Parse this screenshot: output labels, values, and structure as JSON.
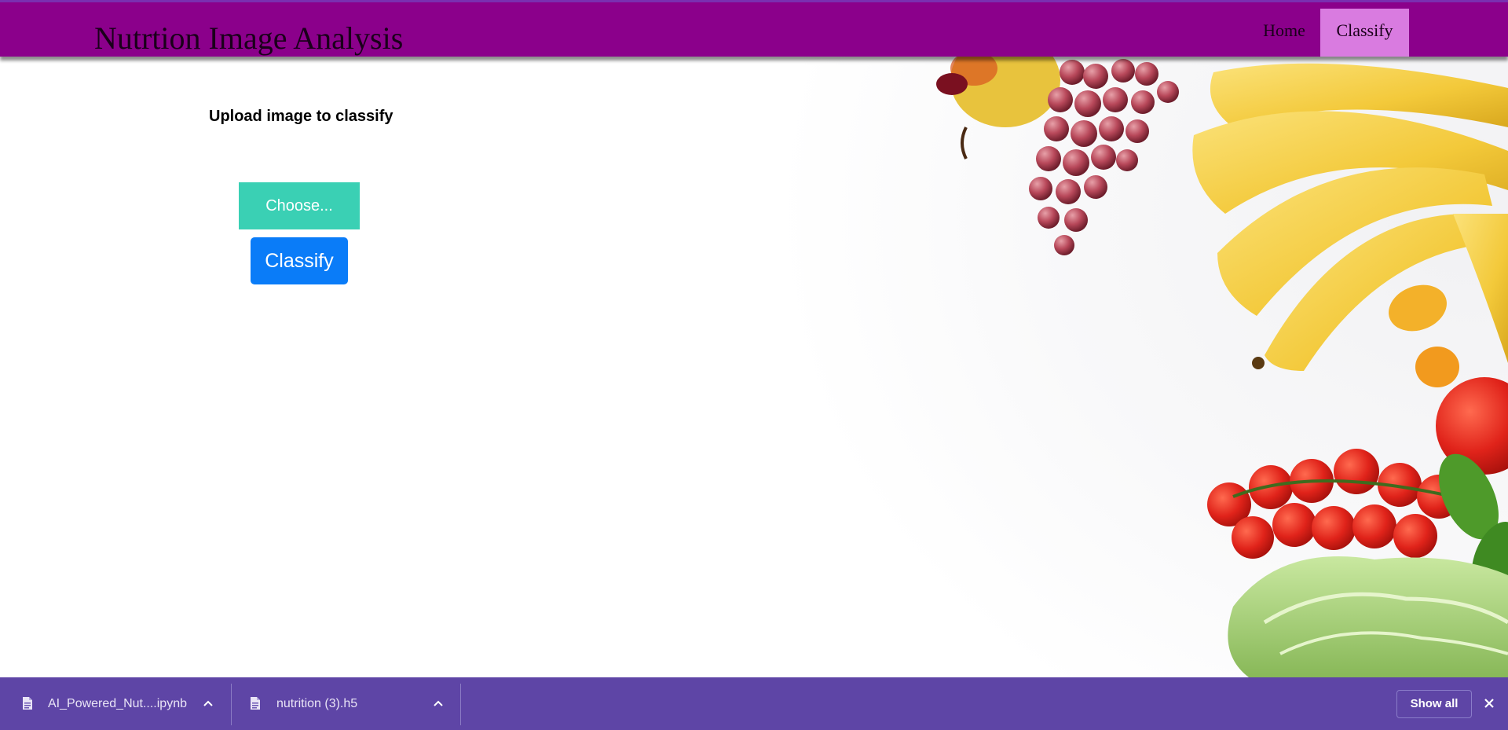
{
  "navbar": {
    "brand": "Nutrtion Image Analysis",
    "links": [
      {
        "label": "Home",
        "active": false
      },
      {
        "label": "Classify",
        "active": true
      }
    ],
    "bg_color": "#8b008b",
    "active_color": "#d97be0"
  },
  "main": {
    "upload_title": "Upload image to classify",
    "choose_label": "Choose...",
    "classify_label": "Classify",
    "choose_color": "#3ad0b4",
    "classify_color": "#0a7cf8"
  },
  "downloads": {
    "items": [
      {
        "name": "AI_Powered_Nut....ipynb",
        "icon": "file-icon"
      },
      {
        "name": "nutrition (3).h5",
        "icon": "file-icon"
      }
    ],
    "show_all_label": "Show all",
    "bar_color": "#5e45a6"
  }
}
